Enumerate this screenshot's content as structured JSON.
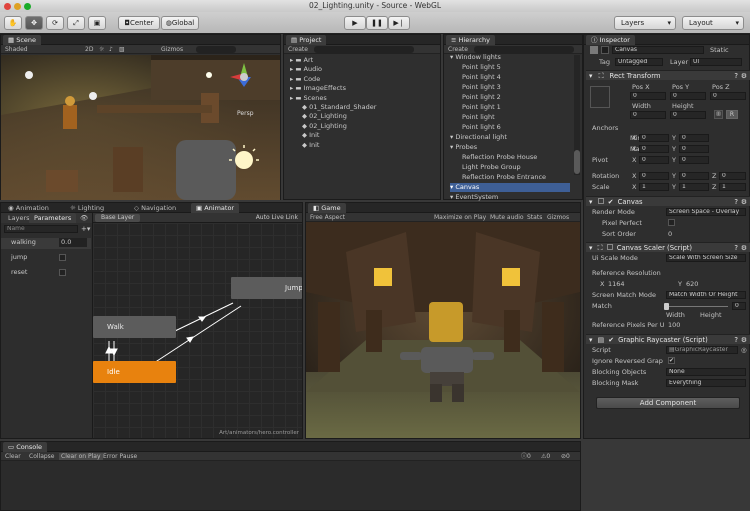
{
  "window": {
    "title": "02_Lighting.unity - Source - WebGL"
  },
  "toolbar": {
    "tools": [
      "hand",
      "move",
      "rotate",
      "scale",
      "rect"
    ],
    "pivot_label": "Center",
    "space_label": "Global",
    "layers_label": "Layers",
    "layout_label": "Layout"
  },
  "scene": {
    "tab": "Scene",
    "shading": "Shaded",
    "mode": "2D",
    "gizmos": "Gizmos",
    "persp": "Persp"
  },
  "project": {
    "tab": "Project",
    "create": "Create",
    "folders": [
      {
        "label": "Art",
        "depth": 0
      },
      {
        "label": "Audio",
        "depth": 0
      },
      {
        "label": "Code",
        "depth": 0
      },
      {
        "label": "ImageEffects",
        "depth": 0
      },
      {
        "label": "Scenes",
        "depth": 0
      },
      {
        "label": "01_Standard_Shader",
        "depth": 1
      },
      {
        "label": "02_Lighting",
        "depth": 1
      },
      {
        "label": "02_Lighting",
        "depth": 1
      },
      {
        "label": "Init",
        "depth": 1
      },
      {
        "label": "Init",
        "depth": 1
      }
    ]
  },
  "hierarchy": {
    "tab": "Hierarchy",
    "create": "Create",
    "items": [
      {
        "label": "Window lights",
        "depth": 0
      },
      {
        "label": "Point light 5",
        "depth": 1
      },
      {
        "label": "Point light 4",
        "depth": 1
      },
      {
        "label": "Point light 3",
        "depth": 1
      },
      {
        "label": "Point light 2",
        "depth": 1
      },
      {
        "label": "Point light 1",
        "depth": 1
      },
      {
        "label": "Point light",
        "depth": 1
      },
      {
        "label": "Point light 6",
        "depth": 1
      },
      {
        "label": "Directional light",
        "depth": 0
      },
      {
        "label": "Probes",
        "depth": 0
      },
      {
        "label": "Reflection Probe House",
        "depth": 1
      },
      {
        "label": "Light Probe Group",
        "depth": 1
      },
      {
        "label": "Reflection Probe Entrance",
        "depth": 1
      },
      {
        "label": "Canvas",
        "depth": 0
      },
      {
        "label": "EventSystem",
        "depth": 0
      }
    ]
  },
  "inspector": {
    "tab": "Inspector",
    "object_name": "Canvas",
    "static_label": "Static",
    "tag_label": "Tag",
    "tag_value": "Untagged",
    "layer_label": "Layer",
    "layer_value": "UI",
    "rect_transform": {
      "title": "Rect Transform",
      "pos_headers": [
        "Pos X",
        "Pos Y",
        "Pos Z"
      ],
      "pos_values": [
        "0",
        "0",
        "0"
      ],
      "size_headers": [
        "Width",
        "Height"
      ],
      "size_values": [
        "0",
        "0"
      ],
      "r_label": "R",
      "anchors": "Anchors",
      "min": "Min",
      "max": "Max",
      "pivot": "Pivot",
      "rotation": "Rotation",
      "scale": "Scale",
      "x": "X",
      "y": "Y",
      "z": "Z",
      "zero": "0",
      "one": "1"
    },
    "canvas": {
      "title": "Canvas",
      "render_mode_label": "Render Mode",
      "render_mode_value": "Screen Space - Overlay",
      "pixel_perfect": "Pixel Perfect",
      "sort_order_label": "Sort Order",
      "sort_order_value": "0"
    },
    "canvas_scaler": {
      "title": "Canvas Scaler (Script)",
      "ui_scale_label": "Ui Scale Mode",
      "ui_scale_value": "Scale With Screen Size",
      "ref_res": "Reference Resolution",
      "x_label": "X",
      "x_value": "1164",
      "y_label": "Y",
      "y_value": "620",
      "match_mode_label": "Screen Match Mode",
      "match_mode_value": "Match Width Or Height",
      "match_label": "Match",
      "match_value": "0",
      "width": "Width",
      "height": "Height",
      "ref_ppu_label": "Reference Pixels Per U",
      "ref_ppu_value": "100"
    },
    "raycaster": {
      "title": "Graphic Raycaster (Script)",
      "script_label": "Script",
      "script_value": "GraphicRaycaster",
      "ignore_label": "Ignore Reversed Grap",
      "blocking_objects_label": "Blocking Objects",
      "blocking_objects_value": "None",
      "blocking_mask_label": "Blocking Mask",
      "blocking_mask_value": "Everything"
    },
    "add_component": "Add Component"
  },
  "animator_tabs": [
    "Animation",
    "Lighting",
    "Navigation",
    "Animator"
  ],
  "animator": {
    "layers_tab": "Layers",
    "params_tab": "Parameters",
    "search_placeholder": "Name",
    "breadcrumb": "Base Layer",
    "auto_live_link": "Auto Live Link",
    "params": [
      {
        "name": "walking",
        "value": "0.0"
      },
      {
        "name": "jump",
        "value": ""
      },
      {
        "name": "reset",
        "value": ""
      }
    ],
    "states": {
      "walk": "Walk",
      "idle": "Idle",
      "jump": "Jump"
    },
    "controller_path": "Art/animators/hero.controller"
  },
  "game": {
    "tab": "Game",
    "aspect": "Free Aspect",
    "maximize": "Maximize on Play",
    "mute": "Mute audio",
    "stats": "Stats",
    "gizmos": "Gizmos"
  },
  "console": {
    "tab": "Console",
    "buttons": [
      "Clear",
      "Collapse",
      "Clear on Play",
      "Error Pause"
    ],
    "counts": [
      "0",
      "0",
      "0"
    ]
  },
  "colors": {
    "idle_state": "#e8820e",
    "state_grey": "#5c5c5c",
    "selection": "#3e5f96"
  }
}
